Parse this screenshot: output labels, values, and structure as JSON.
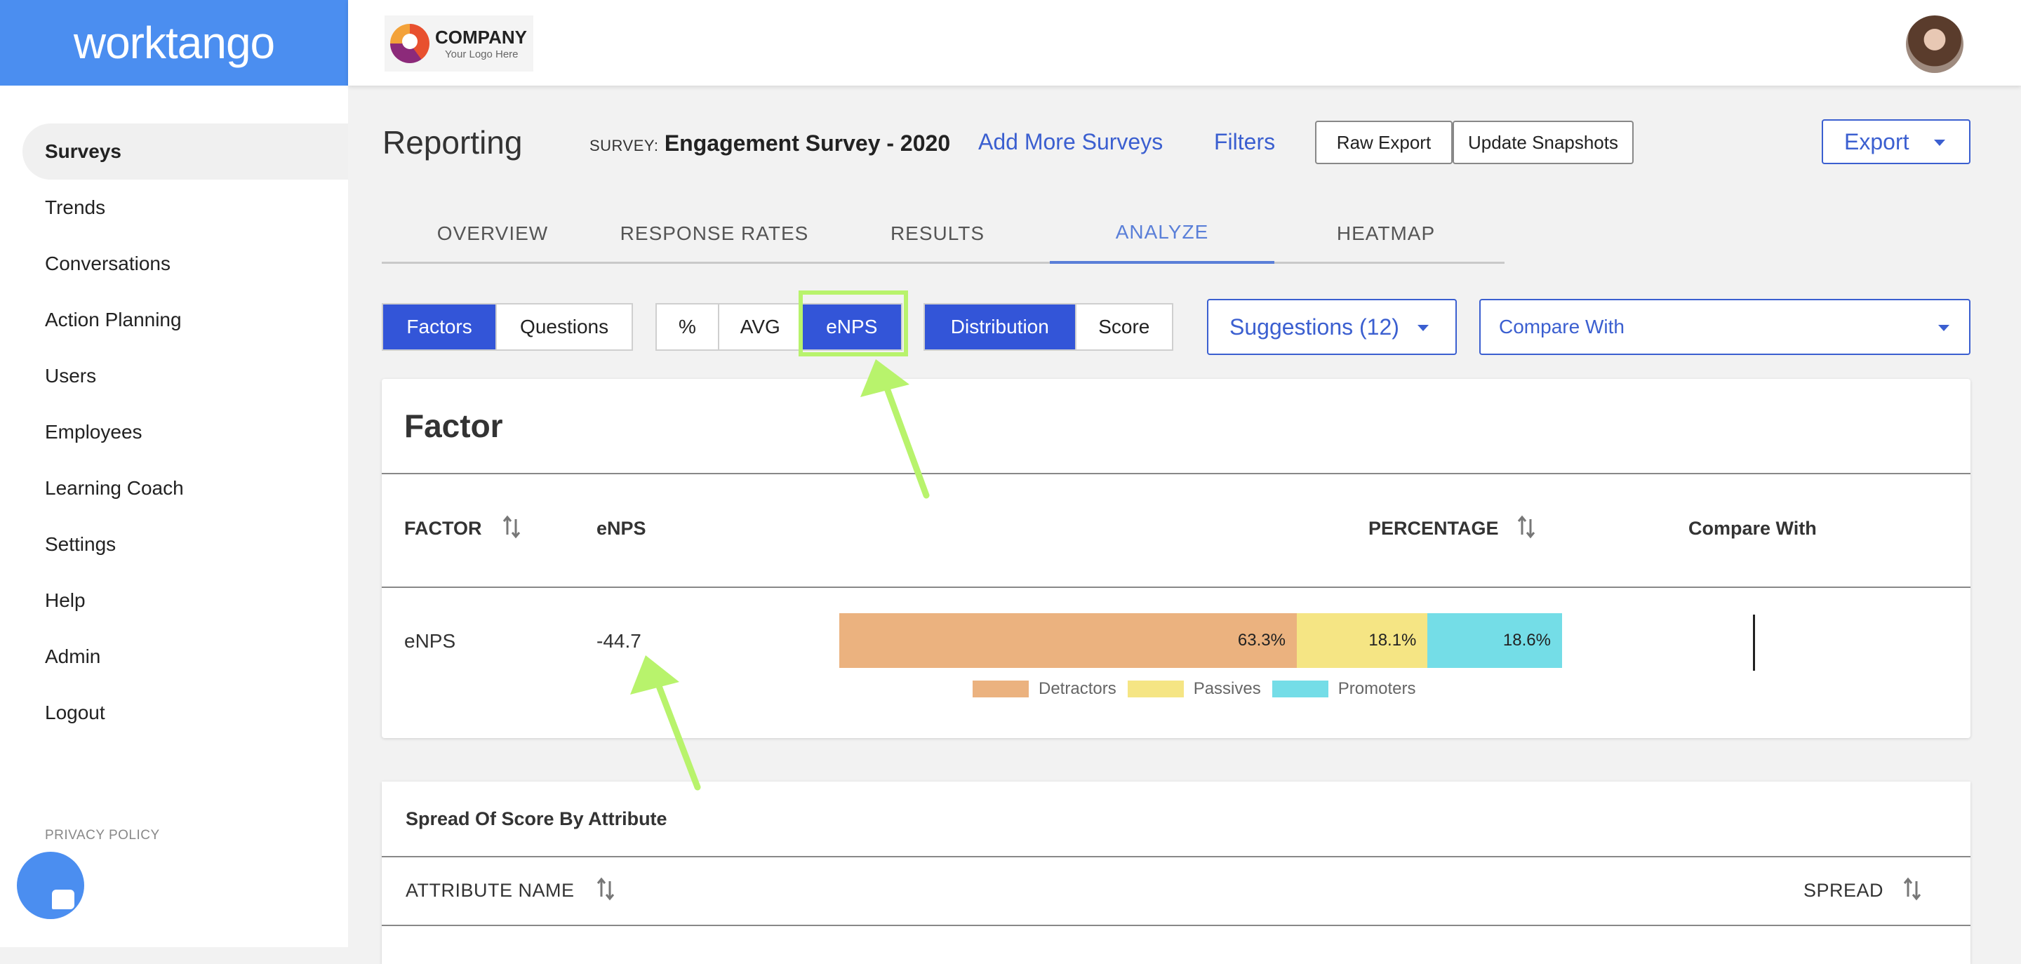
{
  "brand": {
    "name": "worktango"
  },
  "company": {
    "name": "COMPANY",
    "tagline": "Your Logo Here"
  },
  "sidebar": {
    "items": [
      {
        "label": "Surveys",
        "active": true
      },
      {
        "label": "Trends"
      },
      {
        "label": "Conversations"
      },
      {
        "label": "Action Planning"
      },
      {
        "label": "Users"
      },
      {
        "label": "Employees"
      },
      {
        "label": "Learning Coach"
      },
      {
        "label": "Settings"
      },
      {
        "label": "Help"
      },
      {
        "label": "Admin"
      },
      {
        "label": "Logout"
      }
    ],
    "privacy": "PRIVACY POLICY"
  },
  "header": {
    "title": "Reporting",
    "survey_prefix": "SURVEY:",
    "survey_name": "Engagement Survey - 2020",
    "add_surveys": "Add More Surveys",
    "filters": "Filters",
    "raw_export": "Raw Export",
    "update_snapshots": "Update Snapshots",
    "export": "Export"
  },
  "tabs": [
    {
      "label": "OVERVIEW"
    },
    {
      "label": "RESPONSE RATES"
    },
    {
      "label": "RESULTS"
    },
    {
      "label": "ANALYZE",
      "active": true
    },
    {
      "label": "HEATMAP"
    }
  ],
  "toggles": {
    "view": {
      "factors": "Factors",
      "questions": "Questions",
      "selected": "Factors"
    },
    "metric": {
      "percent": "%",
      "avg": "AVG",
      "enps": "eNPS",
      "selected": "eNPS"
    },
    "mode": {
      "distribution": "Distribution",
      "score": "Score",
      "selected": "Distribution"
    },
    "suggestions": "Suggestions (12)",
    "compare_with": "Compare With"
  },
  "factor_card": {
    "title": "Factor",
    "columns": {
      "factor": "FACTOR",
      "enps": "eNPS",
      "percentage": "PERCENTAGE",
      "compare": "Compare With"
    },
    "row": {
      "factor": "eNPS",
      "enps_value": "-44.7",
      "distribution": [
        {
          "name": "Detractors",
          "value": 63.3,
          "label": "63.3%",
          "color": "#ebb27f"
        },
        {
          "name": "Passives",
          "value": 18.1,
          "label": "18.1%",
          "color": "#f5e584"
        },
        {
          "name": "Promoters",
          "value": 18.6,
          "label": "18.6%",
          "color": "#74dde7"
        }
      ]
    }
  },
  "spread_card": {
    "title": "Spread Of Score By Attribute",
    "columns": {
      "attribute": "ATTRIBUTE NAME",
      "spread": "SPREAD"
    }
  },
  "colors": {
    "brand": "#4b8ef0",
    "accent": "#3355d8",
    "link": "#3b5fd0",
    "highlight": "#b8f36c"
  }
}
